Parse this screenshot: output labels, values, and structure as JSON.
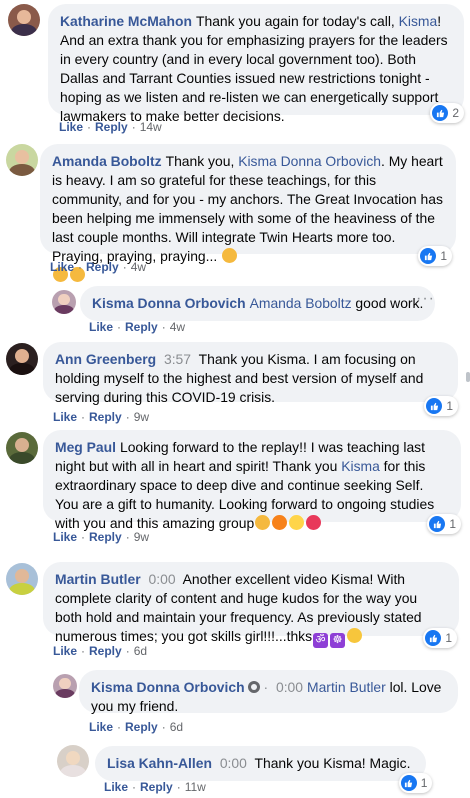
{
  "actions": {
    "like": "Like",
    "reply": "Reply",
    "sep": "·"
  },
  "comments": [
    {
      "name": "Katharine McMahon",
      "text_before": "Thank you again for today's call, ",
      "mention": "Kisma",
      "text_after": "! And an extra thank you for emphasizing prayers for the leaders in every country (and in every local government too). Both Dallas and Tarrant Counties issued new restrictions tonight - hoping as we listen and re-listen we can energetically support lawmakers to make better decisions.",
      "time": "14w",
      "reactions": "2"
    },
    {
      "name": "Amanda Boboltz",
      "text_before": "Thank you, ",
      "mention": "Kisma Donna Orbovich",
      "text_after": ". My heart is heavy. I am so grateful for these teachings, for this community, and for you - my anchors. The Great Invocation has been helping me immensely with some of the heaviness of the last couple months. Will integrate Twin Hearts more too. Praying, praying, praying...",
      "time": "4w",
      "reactions": "1"
    },
    {
      "name": "Kisma Donna Orbovich",
      "mention": "Amanda Boboltz",
      "text_after": " good work.",
      "time": "4w"
    },
    {
      "name": "Ann Greenberg",
      "timestamp": "3:57",
      "text_after": "Thank you Kisma. I am focusing on holding myself to the highest and best version of myself and serving during this COVID-19 crisis.",
      "time": "9w",
      "reactions": "1"
    },
    {
      "name": "Meg Paul",
      "text_before": "Looking forward to the replay!! I was teaching last night but with all in heart and spirit! Thank you ",
      "mention": "Kisma",
      "text_after": " for this extraordinary space to deep dive and continue seeking Self. You are a gift to humanity. Looking forward to ongoing studies with you and this amazing group",
      "time": "9w",
      "reactions": "1"
    },
    {
      "name": "Martin Butler",
      "timestamp": "0:00",
      "text_after": "Another excellent video Kisma! With complete clarity of content and huge kudos for the way you both hold and maintain your frequency. As previously stated numerous times; you got skills girl!!!...thks",
      "time": "6d",
      "reactions": "1"
    },
    {
      "name": "Kisma Donna Orbovich",
      "timestamp": "0:00",
      "mention": "Martin Butler",
      "text_after": " lol. Love you my friend.",
      "time": "6d"
    },
    {
      "name": "Lisa Kahn-Allen",
      "timestamp": "0:00",
      "text_after": "Thank you Kisma! Magic.",
      "time": "11w",
      "reactions": "1"
    }
  ],
  "colors": {
    "link": "#385898",
    "bubble": "#f0f2f5",
    "like_blue": "#1877f2"
  },
  "icons": {
    "more": "more-dots-icon",
    "like": "like-thumb-icon",
    "verified": "verified-badge-icon"
  }
}
